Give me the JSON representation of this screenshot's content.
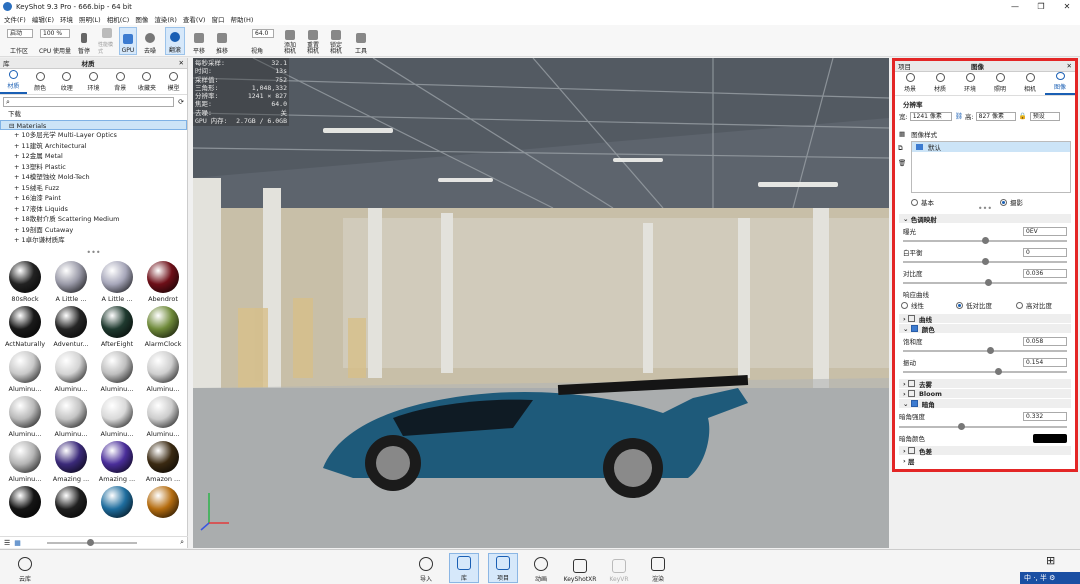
{
  "window": {
    "title": "KeyShot 9.3 Pro  -  666.bip  -  64 bit",
    "controls": [
      "—",
      "❐",
      "✕"
    ]
  },
  "menu": [
    "文件(F)",
    "编辑(E)",
    "环境",
    "照明(L)",
    "相机(C)",
    "图像",
    "渲染(R)",
    "查看(V)",
    "窗口",
    "帮助(H)"
  ],
  "toolbar": {
    "workspace_select": "启动",
    "zoom_select": "100 %",
    "cpu_label": "工作区",
    "cpu_usage": "CPU 使用量",
    "pause": "暂停",
    "perf": "性能模式",
    "gpu": "GPU",
    "denoise": "去噪",
    "flip": "翻滚",
    "pan": "平移",
    "dolly": "推移",
    "fov_value": "64.0",
    "fov": "视角",
    "add_camera": "添加相机",
    "reset_camera": "重置相机",
    "lock_camera": "锁定相机",
    "tools": "工具"
  },
  "left_panel": {
    "header_left": "库",
    "header_center": "材质",
    "tabs": [
      "材质",
      "颜色",
      "纹理",
      "环境",
      "背景",
      "收藏夹",
      "模型"
    ],
    "active_tab": 0,
    "tree": [
      {
        "label": "下载",
        "root": true
      },
      {
        "label": "Materials",
        "root": true,
        "selected": true
      },
      {
        "label": "10多层光学 Multi-Layer Optics"
      },
      {
        "label": "11建筑 Architectural"
      },
      {
        "label": "12金属 Metal"
      },
      {
        "label": "13塑料 Plastic"
      },
      {
        "label": "14模塑蚀纹 Mold-Tech"
      },
      {
        "label": "15绒毛 Fuzz"
      },
      {
        "label": "16油漆 Paint"
      },
      {
        "label": "17液体 Liquids"
      },
      {
        "label": "18散射介质 Scattering Medium"
      },
      {
        "label": "19剖面 Cutaway"
      },
      {
        "label": "1卓尔谦材质库"
      }
    ],
    "materials": [
      {
        "name": "80sRock",
        "color": "#222"
      },
      {
        "name": "A Little ...",
        "color": "#9a9aa8"
      },
      {
        "name": "A Little ...",
        "color": "#a7a7ba"
      },
      {
        "name": "Abendrot",
        "color": "#6e0f18"
      },
      {
        "name": "ActNaturally",
        "color": "#1a1a1a"
      },
      {
        "name": "Adventur...",
        "color": "#262626"
      },
      {
        "name": "AfterEight",
        "color": "#1f3a2f"
      },
      {
        "name": "AlarmClock",
        "color": "#6f8a3a"
      },
      {
        "name": "Aluminu...",
        "color": "#c9c9c9"
      },
      {
        "name": "Aluminu...",
        "color": "#d4d4d4"
      },
      {
        "name": "Aluminu...",
        "color": "#bfbfbf"
      },
      {
        "name": "Aluminu...",
        "color": "#cfcfcf"
      },
      {
        "name": "Aluminu...",
        "color": "#b9b9b9"
      },
      {
        "name": "Aluminu...",
        "color": "#c4c4c4"
      },
      {
        "name": "Aluminu...",
        "color": "#d9d9d9"
      },
      {
        "name": "Aluminu...",
        "color": "#cccccc"
      },
      {
        "name": "Aluminu...",
        "color": "#b5b5b5"
      },
      {
        "name": "Amazing ...",
        "color": "#3b2a7a"
      },
      {
        "name": "Amazing ...",
        "color": "#4a2e9a"
      },
      {
        "name": "Amazon ...",
        "color": "#3b2a12"
      },
      {
        "name": "",
        "color": "#151515"
      },
      {
        "name": "",
        "color": "#202020"
      },
      {
        "name": "",
        "color": "#1e6d9e"
      },
      {
        "name": "",
        "color": "#b56d10"
      }
    ]
  },
  "viewport": {
    "stats": [
      [
        "每秒采样:",
        "32.1"
      ],
      [
        "时间:",
        "13s"
      ],
      [
        "采样值:",
        "752"
      ],
      [
        "三角形:",
        "1,048,332"
      ],
      [
        "分辨率:",
        "1241 × 827"
      ],
      [
        "焦距:",
        "64.0"
      ],
      [
        "去噪:",
        "关"
      ],
      [
        "GPU 内存:",
        "2.7GB / 6.0GB"
      ]
    ]
  },
  "right_panel": {
    "header_left": "项目",
    "header_center": "图像",
    "tabs": [
      "场景",
      "材质",
      "环境",
      "照明",
      "相机",
      "图像"
    ],
    "active_tab": 5,
    "resolution_label": "分辨率",
    "width_label": "宽:",
    "width_value": "1241 像素",
    "height_label": "高:",
    "height_value": "827 像素",
    "preset": "预设",
    "style_label": "图像样式",
    "style_item": "默认",
    "mode_basic": "基本",
    "mode_photo": "摄影",
    "tonemap_section": "色调映射",
    "exposure_label": "曝光",
    "exposure_value": "0EV",
    "wb_label": "白平衡",
    "wb_value": "0",
    "contrast_label": "对比度",
    "contrast_value": "0.036",
    "curve_label": "响应曲线",
    "curve_linear": "线性",
    "curve_low": "低对比度",
    "curve_high": "高对比度",
    "curves_section": "曲线",
    "color_section": "颜色",
    "saturation_label": "饱和度",
    "saturation_value": "0.058",
    "vibrance_label": "振动",
    "vibrance_value": "0.154",
    "dehaze_section": "去雾",
    "bloom_section": "Bloom",
    "vignette_section": "暗角",
    "vignette_strength_label": "暗角强度",
    "vignette_strength_value": "0.332",
    "vignette_color_label": "暗角颜色",
    "chromatic_section": "色差",
    "layer_section": "层"
  },
  "bottom_bar": {
    "cloud": "云库",
    "import": "导入",
    "library": "库",
    "project": "项目",
    "animation": "动画",
    "keyshotxr": "KeyShotXR",
    "keyvr": "KeyVR",
    "render": "渲染",
    "ime": "中 ·, 半 ⚙"
  },
  "levels": {
    "exposure": 0.5,
    "white_balance": 0.5,
    "contrast": 0.52,
    "saturation": 0.53,
    "vibrance": 0.58,
    "vignette_strength": 0.37
  }
}
